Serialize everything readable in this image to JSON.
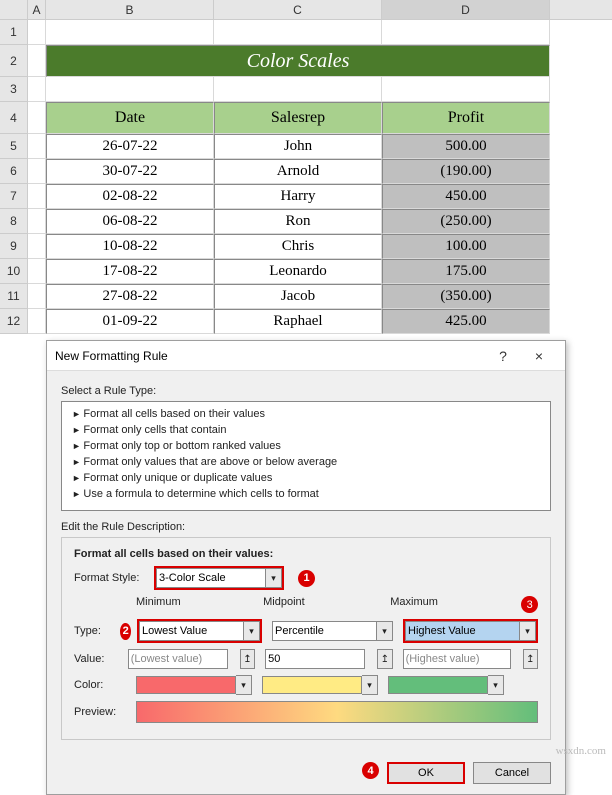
{
  "columns": [
    "A",
    "B",
    "C",
    "D"
  ],
  "rowNumbers": [
    1,
    2,
    3,
    4,
    5,
    6,
    7,
    8,
    9,
    10,
    11,
    12
  ],
  "title": "Color Scales",
  "headers": {
    "date": "Date",
    "rep": "Salesrep",
    "profit": "Profit"
  },
  "data": [
    {
      "date": "26-07-22",
      "rep": "John",
      "profit": "500.00"
    },
    {
      "date": "30-07-22",
      "rep": "Arnold",
      "profit": "(190.00)"
    },
    {
      "date": "02-08-22",
      "rep": "Harry",
      "profit": "450.00"
    },
    {
      "date": "06-08-22",
      "rep": "Ron",
      "profit": "(250.00)"
    },
    {
      "date": "10-08-22",
      "rep": "Chris",
      "profit": "100.00"
    },
    {
      "date": "17-08-22",
      "rep": "Leonardo",
      "profit": "175.00"
    },
    {
      "date": "27-08-22",
      "rep": "Jacob",
      "profit": "(350.00)"
    },
    {
      "date": "01-09-22",
      "rep": "Raphael",
      "profit": "425.00"
    }
  ],
  "dialog": {
    "title": "New Formatting Rule",
    "help": "?",
    "close": "×",
    "selectRule": "Select a Rule Type:",
    "rules": [
      "Format all cells based on their values",
      "Format only cells that contain",
      "Format only top or bottom ranked values",
      "Format only values that are above or below average",
      "Format only unique or duplicate values",
      "Use a formula to determine which cells to format"
    ],
    "editDesc": "Edit the Rule Description:",
    "editHead": "Format all cells based on their values:",
    "formatStyleLbl": "Format Style:",
    "formatStyleVal": "3-Color Scale",
    "colLabels": {
      "min": "Minimum",
      "mid": "Midpoint",
      "max": "Maximum"
    },
    "typeLbl": "Type:",
    "typeMin": "Lowest Value",
    "typeMid": "Percentile",
    "typeMax": "Highest Value",
    "valueLbl": "Value:",
    "valueMin": "(Lowest value)",
    "valueMid": "50",
    "valueMax": "(Highest value)",
    "colorLbl": "Color:",
    "previewLbl": "Preview:",
    "ok": "OK",
    "cancel": "Cancel",
    "callouts": {
      "c1": "1",
      "c2": "2",
      "c3": "3",
      "c4": "4"
    }
  },
  "watermark": "wsxdn.com"
}
